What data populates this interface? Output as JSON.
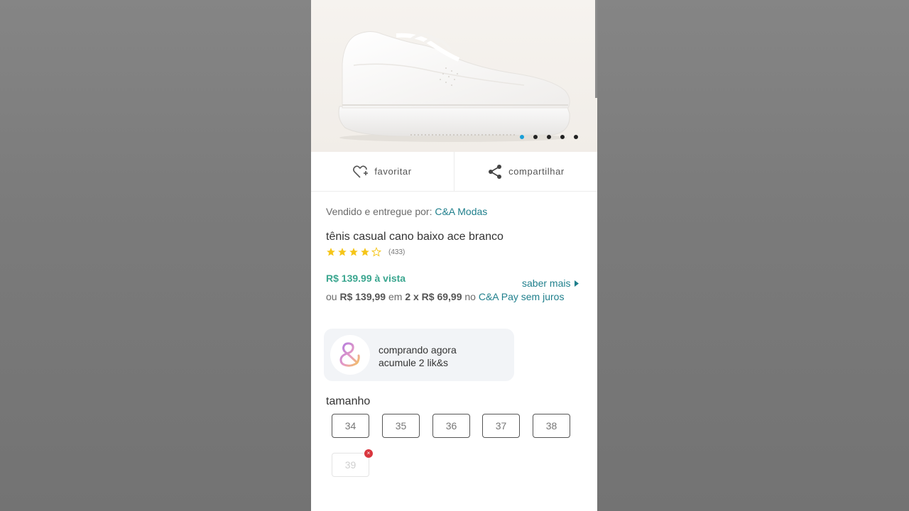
{
  "product_gallery": {
    "image_subject": "white sneaker",
    "slide_count": 5,
    "active_index": 0
  },
  "actions": {
    "favorite_label": "favoritar",
    "share_label": "compartilhar"
  },
  "seller": {
    "prefix": "Vendido e entregue por:",
    "name": "C&A Modas"
  },
  "product": {
    "title": "tênis casual cano baixo ace branco",
    "rating": 4,
    "rating_max": 5,
    "rating_count": "(433)"
  },
  "price": {
    "cash": "R$ 139.99 à vista",
    "more_link": "saber mais",
    "installment_prefix": "ou",
    "installment_total": "R$ 139,99",
    "installment_mid": "em",
    "installment_detail": "2 x R$ 69,99",
    "installment_mid2": "no",
    "installment_method": "C&A Pay sem juros"
  },
  "likes": {
    "line1": "comprando agora",
    "line2": "acumule 2 lik&s"
  },
  "sizes": {
    "label": "tamanho",
    "options": [
      {
        "value": "34",
        "available": true
      },
      {
        "value": "35",
        "available": true
      },
      {
        "value": "36",
        "available": true
      },
      {
        "value": "37",
        "available": true
      },
      {
        "value": "38",
        "available": true
      },
      {
        "value": "39",
        "available": false
      }
    ],
    "unavailable_badge": "×"
  },
  "colors": {
    "accent_link": "#1f7f8c",
    "price_green": "#3aa68f",
    "dot_active": "#1a9fd8",
    "unavailable_badge": "#d9363e",
    "star_fill": "#f5c518"
  }
}
